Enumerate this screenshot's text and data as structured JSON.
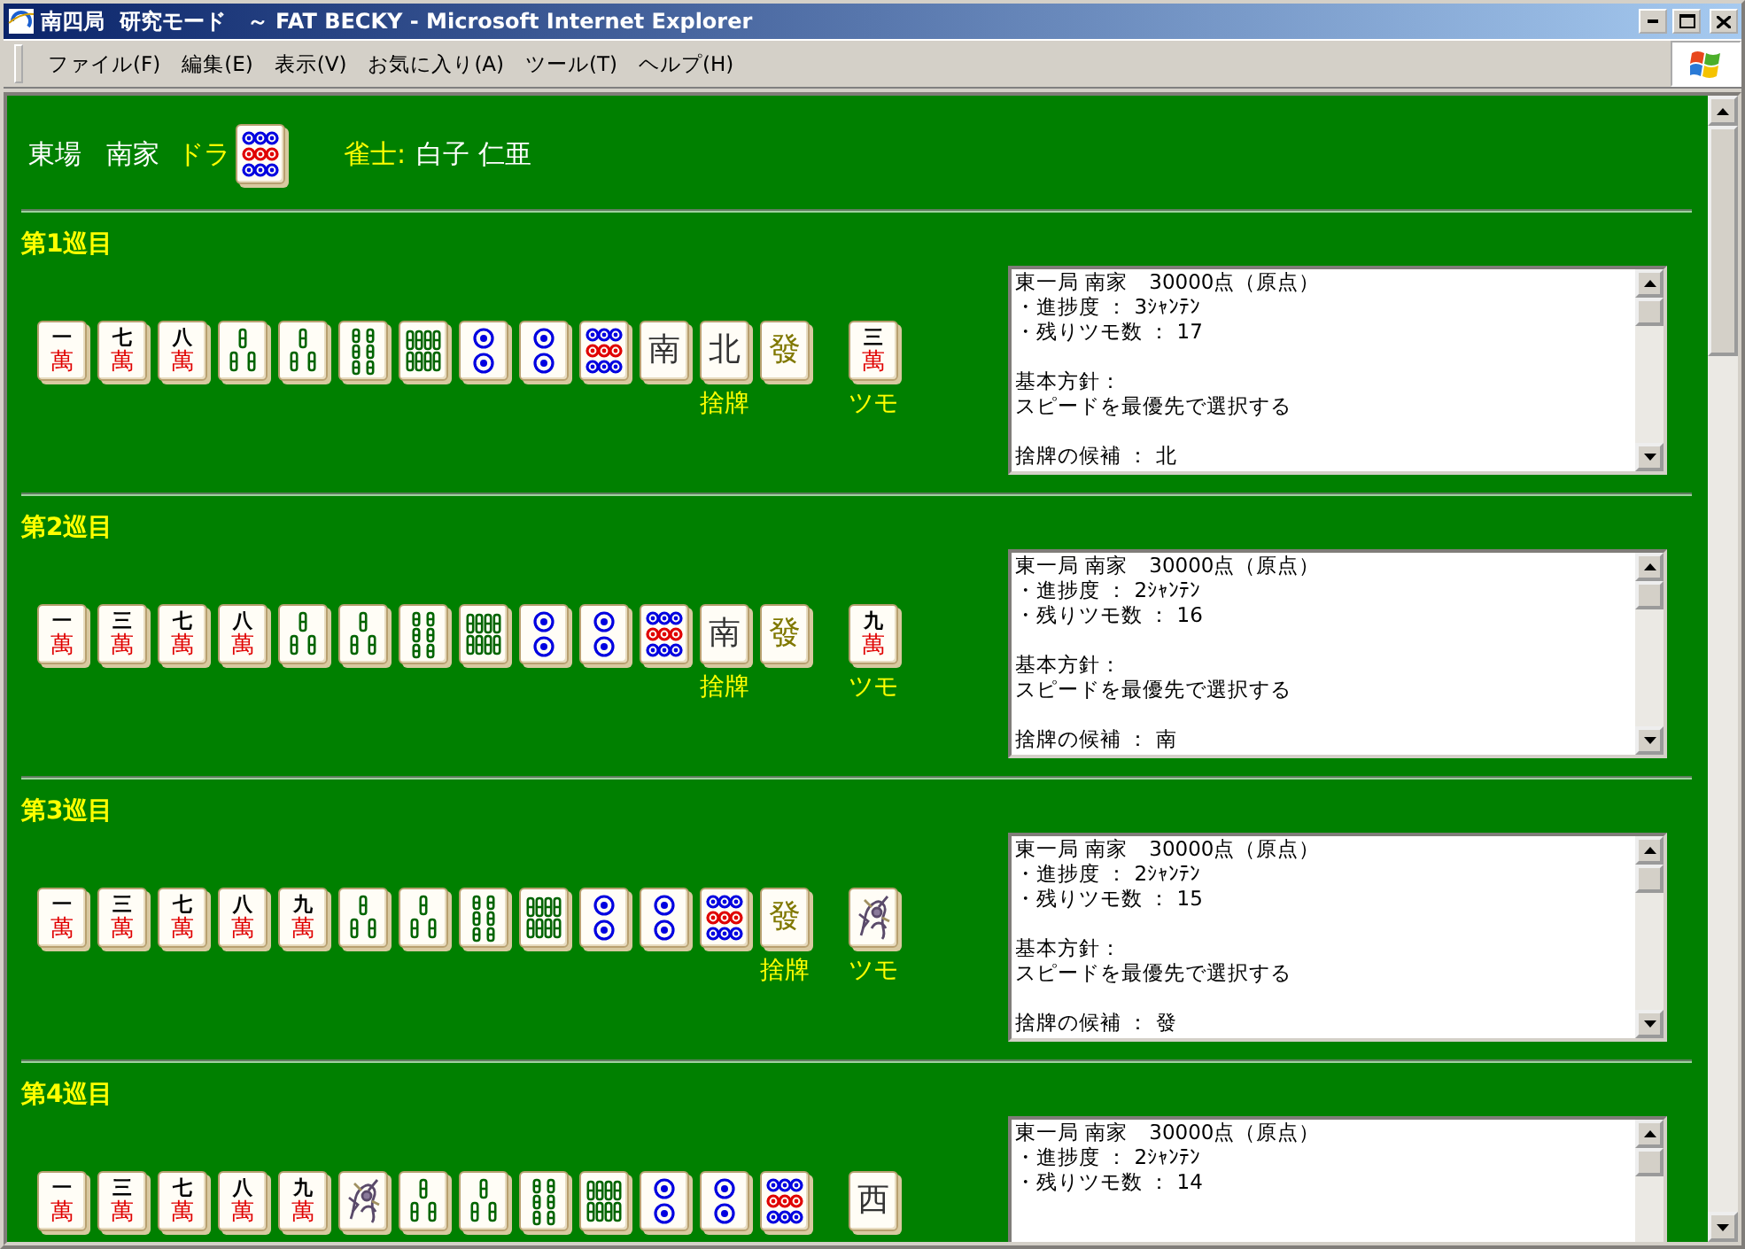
{
  "window": {
    "title": "南四局  研究モード　～ FAT BECKY - Microsoft Internet Explorer"
  },
  "menu": [
    "ファイル(F)",
    "編集(E)",
    "表示(V)",
    "お気に入り(A)",
    "ツール(T)",
    "ヘルプ(H)"
  ],
  "header": {
    "round_wind": "東場",
    "seat": "南家",
    "dora_label": "ドラ",
    "dora": {
      "kind": "pin9"
    },
    "player_label": "雀士:",
    "player": "白子 仁亜"
  },
  "rounds": [
    {
      "title": "第1巡目",
      "hand": [
        {
          "kind": "man",
          "rank": "一",
          "suit": "萬"
        },
        {
          "kind": "man",
          "rank": "七",
          "suit": "萬"
        },
        {
          "kind": "man",
          "rank": "八",
          "suit": "萬"
        },
        {
          "kind": "sou3"
        },
        {
          "kind": "sou3"
        },
        {
          "kind": "sou6"
        },
        {
          "kind": "sou8"
        },
        {
          "kind": "pin2"
        },
        {
          "kind": "pin2"
        },
        {
          "kind": "pin9"
        },
        {
          "kind": "honor",
          "face": "南"
        },
        {
          "kind": "honor",
          "face": "北",
          "caption": "捨牌"
        },
        {
          "kind": "dragon",
          "face": "發"
        }
      ],
      "draw": {
        "kind": "man",
        "rank": "三",
        "suit": "萬",
        "caption": "ツモ"
      },
      "memo": [
        [
          "東一局 南家　30000点（原点）",
          "・進捗度 ： 3ｼｬﾝﾃﾝ",
          "・残りツモ数 ： 17"
        ],
        [
          "基本方針：",
          "スピードを最優先で選択する"
        ],
        [
          "捨牌の候補 ： 北"
        ]
      ]
    },
    {
      "title": "第2巡目",
      "hand": [
        {
          "kind": "man",
          "rank": "一",
          "suit": "萬"
        },
        {
          "kind": "man",
          "rank": "三",
          "suit": "萬"
        },
        {
          "kind": "man",
          "rank": "七",
          "suit": "萬"
        },
        {
          "kind": "man",
          "rank": "八",
          "suit": "萬"
        },
        {
          "kind": "sou3"
        },
        {
          "kind": "sou3"
        },
        {
          "kind": "sou6"
        },
        {
          "kind": "sou8"
        },
        {
          "kind": "pin2"
        },
        {
          "kind": "pin2"
        },
        {
          "kind": "pin9"
        },
        {
          "kind": "honor",
          "face": "南",
          "caption": "捨牌"
        },
        {
          "kind": "dragon",
          "face": "發"
        }
      ],
      "draw": {
        "kind": "man",
        "rank": "九",
        "suit": "萬",
        "caption": "ツモ"
      },
      "memo": [
        [
          "東一局 南家　30000点（原点）",
          "・進捗度 ： 2ｼｬﾝﾃﾝ",
          "・残りツモ数 ： 16"
        ],
        [
          "基本方針：",
          "スピードを最優先で選択する"
        ],
        [
          "捨牌の候補 ： 南"
        ]
      ]
    },
    {
      "title": "第3巡目",
      "hand": [
        {
          "kind": "man",
          "rank": "一",
          "suit": "萬"
        },
        {
          "kind": "man",
          "rank": "三",
          "suit": "萬"
        },
        {
          "kind": "man",
          "rank": "七",
          "suit": "萬"
        },
        {
          "kind": "man",
          "rank": "八",
          "suit": "萬"
        },
        {
          "kind": "man",
          "rank": "九",
          "suit": "萬"
        },
        {
          "kind": "sou3"
        },
        {
          "kind": "sou3"
        },
        {
          "kind": "sou6"
        },
        {
          "kind": "sou8"
        },
        {
          "kind": "pin2"
        },
        {
          "kind": "pin2"
        },
        {
          "kind": "pin9"
        },
        {
          "kind": "dragon",
          "face": "發",
          "caption": "捨牌"
        }
      ],
      "draw": {
        "kind": "art",
        "caption": "ツモ"
      },
      "memo": [
        [
          "東一局 南家　30000点（原点）",
          "・進捗度 ： 2ｼｬﾝﾃﾝ",
          "・残りツモ数 ： 15"
        ],
        [
          "基本方針：",
          "スピードを最優先で選択する"
        ],
        [
          "捨牌の候補 ： 發"
        ]
      ]
    },
    {
      "title": "第4巡目",
      "hand": [
        {
          "kind": "man",
          "rank": "一",
          "suit": "萬"
        },
        {
          "kind": "man",
          "rank": "三",
          "suit": "萬"
        },
        {
          "kind": "man",
          "rank": "七",
          "suit": "萬"
        },
        {
          "kind": "man",
          "rank": "八",
          "suit": "萬"
        },
        {
          "kind": "man",
          "rank": "九",
          "suit": "萬"
        },
        {
          "kind": "art"
        },
        {
          "kind": "sou3"
        },
        {
          "kind": "sou3"
        },
        {
          "kind": "sou6"
        },
        {
          "kind": "sou8"
        },
        {
          "kind": "pin2"
        },
        {
          "kind": "pin2"
        },
        {
          "kind": "pin9"
        }
      ],
      "draw": {
        "kind": "honor",
        "face": "西"
      },
      "memo": [
        [
          "東一局 南家　30000点（原点）",
          "・進捗度 ： 2ｼｬﾝﾃﾝ",
          "・残りツモ数 ： 14"
        ]
      ]
    }
  ]
}
